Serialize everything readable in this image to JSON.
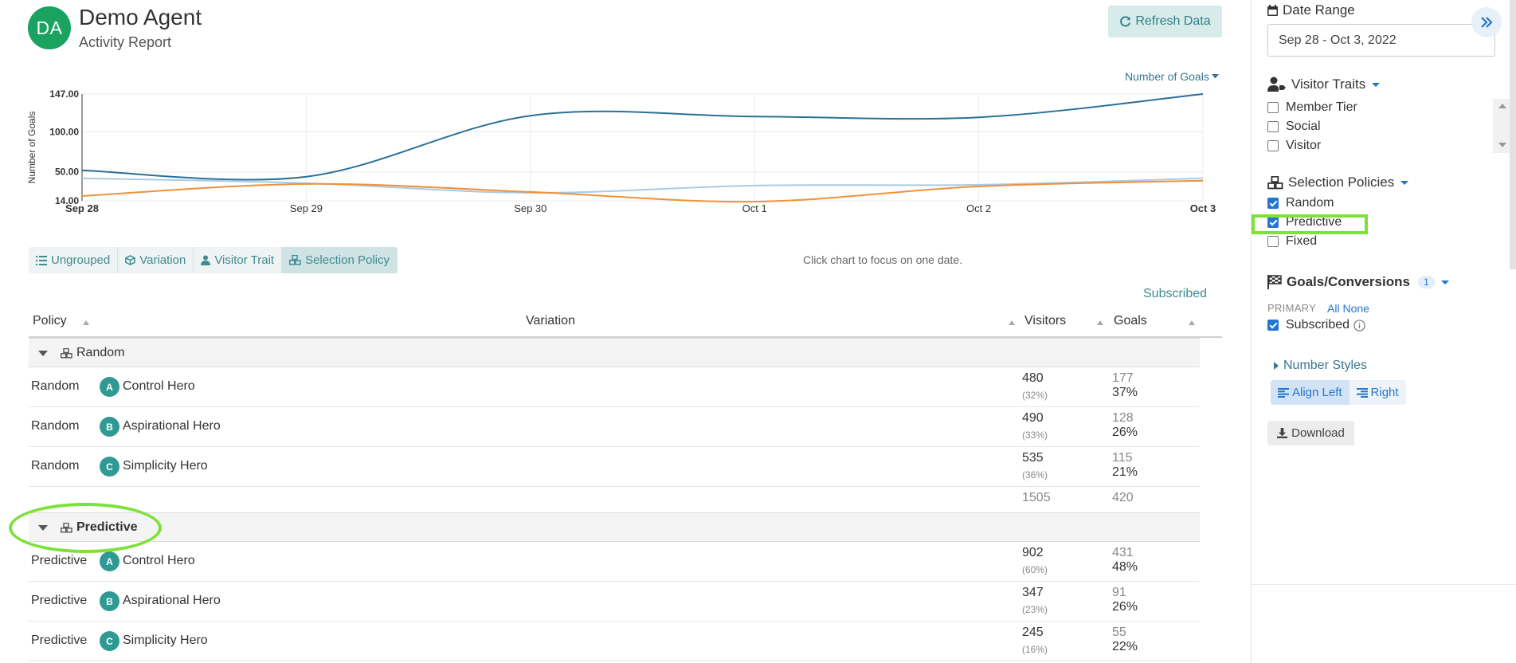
{
  "header": {
    "avatar_initials": "DA",
    "agent_name": "Demo Agent",
    "subtitle": "Activity Report",
    "refresh_label": "Refresh Data",
    "metric_dropdown": "Number of Goals"
  },
  "chart_data": {
    "type": "line",
    "ylabel": "Number of Goals",
    "y_ticks": [
      "147.00",
      "100.00",
      "50.00",
      "14.00"
    ],
    "ylim": [
      14,
      147
    ],
    "x_labels": [
      "Sep 28",
      "Sep 29",
      "Sep 30",
      "Oct 1",
      "Oct 2",
      "Oct 3"
    ],
    "grid": true,
    "colors": {
      "dark": "#2b7196",
      "light": "#a9cbe6",
      "orange": "#f0913a"
    },
    "series": [
      {
        "values": [
          52,
          44,
          120,
          119,
          118,
          147
        ]
      },
      {
        "values": [
          42,
          36,
          24,
          33,
          34,
          42
        ]
      },
      {
        "values": [
          20,
          35,
          25,
          13,
          32,
          39
        ]
      }
    ]
  },
  "grouping": {
    "tabs": [
      "Ungrouped",
      "Variation",
      "Visitor Trait",
      "Selection Policy"
    ],
    "active": "Selection Policy",
    "hint": "Click chart to focus on one date."
  },
  "table": {
    "top_header": "Subscribed",
    "columns": [
      "Policy",
      "Variation",
      "Visitors",
      "Goals"
    ],
    "groups": [
      {
        "name": "Random",
        "rows": [
          {
            "policy": "Random",
            "badge": "A",
            "variation": "Control Hero",
            "visitors": "480",
            "visitors_pct": "(32%)",
            "goals": "177",
            "goals_pct": "37%"
          },
          {
            "policy": "Random",
            "badge": "B",
            "variation": "Aspirational Hero",
            "visitors": "490",
            "visitors_pct": "(33%)",
            "goals": "128",
            "goals_pct": "26%"
          },
          {
            "policy": "Random",
            "badge": "C",
            "variation": "Simplicity Hero",
            "visitors": "535",
            "visitors_pct": "(36%)",
            "goals": "115",
            "goals_pct": "21%"
          }
        ],
        "total_visitors": "1505",
        "total_goals": "420"
      },
      {
        "name": "Predictive",
        "rows": [
          {
            "policy": "Predictive",
            "badge": "A",
            "variation": "Control Hero",
            "visitors": "902",
            "visitors_pct": "(60%)",
            "goals": "431",
            "goals_pct": "48%"
          },
          {
            "policy": "Predictive",
            "badge": "B",
            "variation": "Aspirational Hero",
            "visitors": "347",
            "visitors_pct": "(23%)",
            "goals": "91",
            "goals_pct": "26%"
          },
          {
            "policy": "Predictive",
            "badge": "C",
            "variation": "Simplicity Hero",
            "visitors": "245",
            "visitors_pct": "(16%)",
            "goals": "55",
            "goals_pct": "22%"
          }
        ]
      }
    ]
  },
  "sidebar": {
    "date_range_title": "Date Range",
    "date_range_value": "Sep 28 - Oct 3, 2022",
    "visitor_traits_title": "Visitor Traits",
    "visitor_traits": [
      {
        "label": "Member Tier",
        "checked": false
      },
      {
        "label": "Social",
        "checked": false
      },
      {
        "label": "Visitor",
        "checked": false
      }
    ],
    "selection_policies_title": "Selection Policies",
    "selection_policies": [
      {
        "label": "Random",
        "checked": true
      },
      {
        "label": "Predictive",
        "checked": true
      },
      {
        "label": "Fixed",
        "checked": false
      }
    ],
    "goals_title": "Goals/Conversions",
    "goals_count": "1",
    "primary_label": "PRIMARY",
    "all_label": "All",
    "none_label": "None",
    "goal_item": {
      "label": "Subscribed",
      "checked": true
    },
    "number_styles_label": "Number Styles",
    "align_left_label": "Align Left",
    "align_right_label": "Right",
    "download_label": "Download"
  }
}
